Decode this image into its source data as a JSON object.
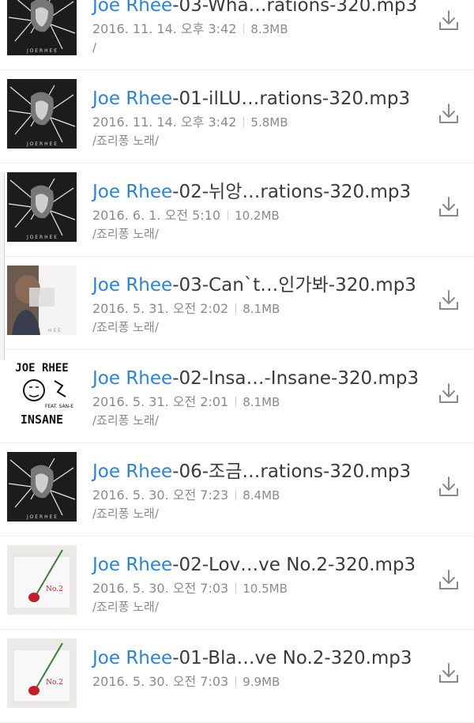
{
  "files": [
    {
      "prefix": "Joe Rhee",
      "rest": "-03-Wha…rations-320.mp3",
      "date": "2016. 11. 14. 오후 3:42",
      "size": "8.3MB",
      "path": "/",
      "art": "sketch",
      "thumb_label": "J O E R H E E"
    },
    {
      "prefix": "Joe Rhee",
      "rest": "-01-ilLU…rations-320.mp3",
      "date": "2016. 11. 14. 오후 3:42",
      "size": "5.8MB",
      "path": "/죠리퐁 노래/",
      "art": "sketch",
      "thumb_label": "J O E R H E E"
    },
    {
      "prefix": "Joe Rhee",
      "rest": "-02-뉘앙…rations-320.mp3",
      "date": "2016. 6. 1. 오전 5:10",
      "size": "10.2MB",
      "path": "/죠리퐁 노래/",
      "art": "sketch",
      "thumb_label": "J O E R H E E"
    },
    {
      "prefix": "Joe Rhee",
      "rest": "-03-Can`t…인가봐-320.mp3",
      "date": "2016. 5. 31. 오전 2:02",
      "size": "8.1MB",
      "path": "/죠리퐁 노래/",
      "art": "photo",
      "thumb_label": "H E E"
    },
    {
      "prefix": "Joe Rhee",
      "rest": "-02-Insa…-Insane-320.mp3",
      "date": "2016. 5. 31. 오전 2:01",
      "size": "8.1MB",
      "path": "/죠리퐁 노래/",
      "art": "insane",
      "thumb_label": "JOE RHEE",
      "thumb_label2": "FEAT. SAN-E",
      "thumb_label3": "INSANE"
    },
    {
      "prefix": "Joe Rhee",
      "rest": "-06-조금…rations-320.mp3",
      "date": "2016. 5. 30. 오전 7:23",
      "size": "8.4MB",
      "path": "/죠리퐁 노래/",
      "art": "sketch",
      "thumb_label": "J O E R H E E"
    },
    {
      "prefix": "Joe Rhee",
      "rest": "-02-Lov…ve No.2-320.mp3",
      "date": "2016. 5. 30. 오전 7:03",
      "size": "10.5MB",
      "path": "/죠리퐁 노래/",
      "art": "rose",
      "thumb_label": "No.2"
    },
    {
      "prefix": "Joe Rhee",
      "rest": "-01-Bla…ve No.2-320.mp3",
      "date": "2016. 5. 30. 오전 7:03",
      "size": "9.9MB",
      "path": "",
      "art": "rose",
      "thumb_label": "No.2"
    }
  ],
  "icons": {
    "download": "download-icon"
  },
  "colors": {
    "highlight": "#2b83d6",
    "text": "#3a3a3a",
    "meta": "#8a8a8a"
  }
}
